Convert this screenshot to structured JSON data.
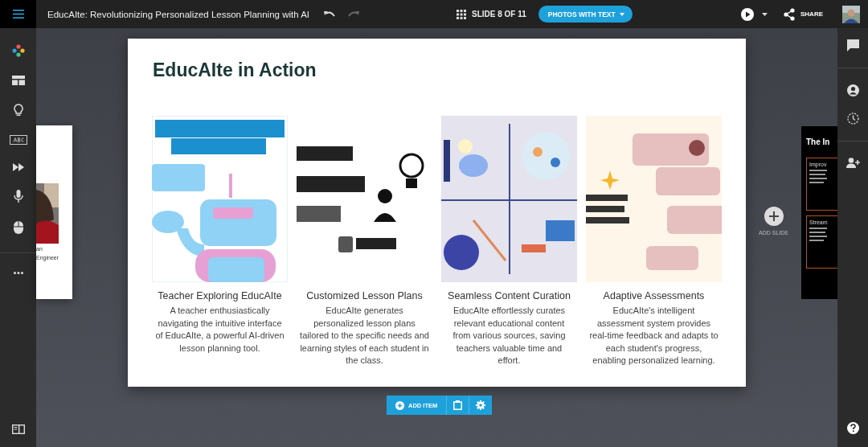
{
  "topbar": {
    "title": "EducAIte: Revolutionizing Personalized Lesson Planning with AI",
    "slide_counter": "SLIDE 8 OF 11",
    "layout_button": "PHOTOS WITH TEXT",
    "share": "SHARE"
  },
  "left_preview": {
    "lines": [
      "an",
      "Engineer"
    ]
  },
  "slide": {
    "title": "EducAIte in Action",
    "cards": [
      {
        "kind": "picture",
        "caption": "Teacher Exploring EducAIte",
        "description": "A teacher enthusiastically navigating the intuitive interface of EducAIte, a powerful AI-driven lesson planning tool."
      },
      {
        "kind": "picture",
        "caption": "Customized Lesson Plans",
        "description": "EducAIte generates personalized lesson plans tailored to the specific needs and learning styles of each student in the class."
      },
      {
        "kind": "picture",
        "caption": "Seamless Content Curation",
        "description": "EducAIte effortlessly curates relevant educational content from various sources, saving teachers valuable time and effort."
      },
      {
        "kind": "picture",
        "caption": "Adaptive Assessments",
        "description": "EducAIte's intelligent assessment system provides real-time feedback and adapts to each student's progress, enabling personalized learning."
      }
    ]
  },
  "add_slide": "ADD SLIDE",
  "right_preview": {
    "title": "The In",
    "boxes": [
      "Improv",
      "Stream"
    ]
  },
  "toolbar": {
    "add_item": "ADD ITEM"
  }
}
